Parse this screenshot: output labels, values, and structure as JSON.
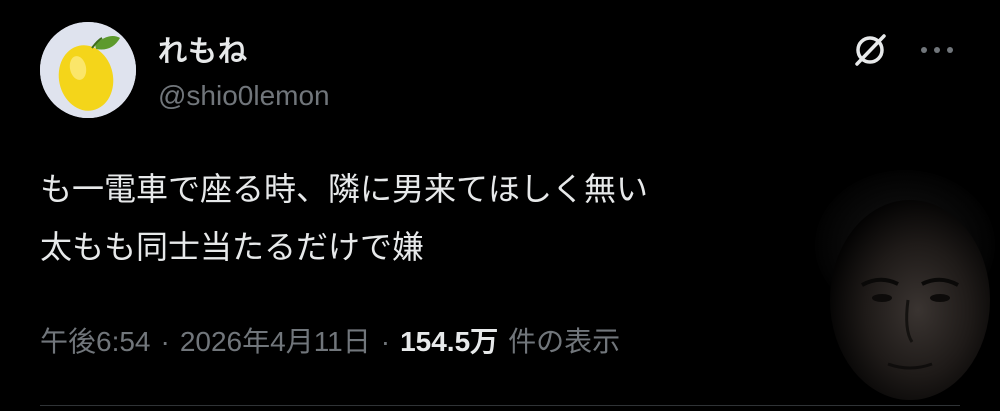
{
  "user": {
    "display_name": "れもね",
    "handle": "@shio0lemon"
  },
  "tweet": {
    "lines": [
      "も一電車で座る時、隣に男来てほしく無い",
      "太もも同士当たるだけで嫌"
    ]
  },
  "meta": {
    "time": "午後6:54",
    "separator": "·",
    "date": "2026年4月11日",
    "views_count": "154.5万",
    "views_label": "件の表示"
  },
  "icons": {
    "avatar": "lemon-avatar",
    "grok": "grok-icon",
    "more": "more-icon"
  },
  "colors": {
    "background": "#000000",
    "text": "#e7e9ea",
    "muted": "#71767b"
  }
}
